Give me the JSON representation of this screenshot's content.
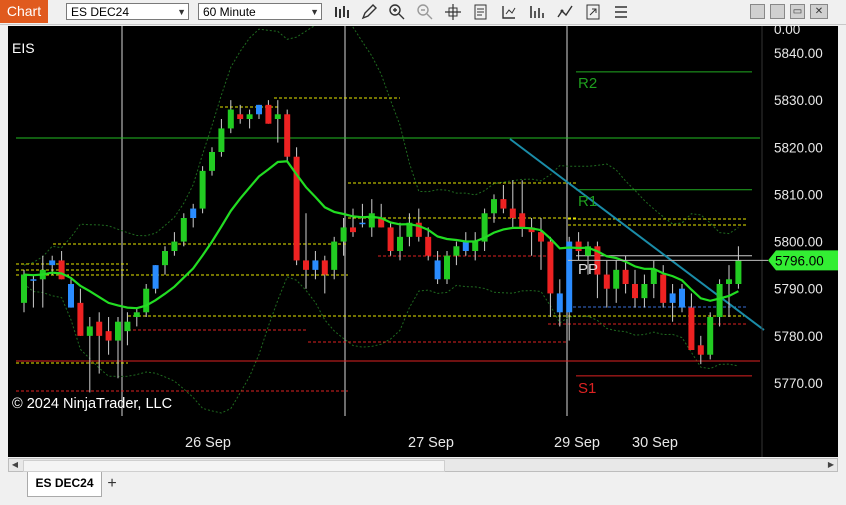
{
  "toolbar": {
    "chart_label": "Chart",
    "instrument": "ES DEC24",
    "interval": "60 Minute",
    "icons": [
      "bars-type-icon",
      "draw-pencil-icon",
      "zoom-in-icon",
      "zoom-out-icon",
      "crosshair-icon",
      "properties-icon",
      "strategies-icon",
      "indicators-icon",
      "templates-icon",
      "share-icon",
      "more-icon"
    ],
    "window_buttons": [
      "minimize",
      "maximize",
      "close"
    ]
  },
  "chart": {
    "symbol_label": "EIS",
    "copyright": "© 2024 NinjaTrader, LLC",
    "x_labels": [
      "26 Sep",
      "27 Sep",
      "29 Sep",
      "30 Sep"
    ],
    "y_labels": [
      "5840.00",
      "5830.00",
      "5820.00",
      "5810.00",
      "5800.00",
      "5790.00",
      "5780.00",
      "5770.00"
    ],
    "top_partial_label": "0.00",
    "current_price": "5796.00",
    "pivot_labels": {
      "r2": "R2",
      "r1": "R1",
      "pp": "PP",
      "s1": "S1"
    },
    "colors": {
      "up": "#22cc22",
      "down": "#ee2222",
      "neutral": "#2a8cff",
      "ema": "#22dd22",
      "price_tag": "#33ee33",
      "trendline": "#1a8ca8"
    }
  },
  "chart_data": {
    "type": "candlestick",
    "ylim": [
      5766,
      5842
    ],
    "price_levels": {
      "R2": 5836,
      "R1": 5811,
      "PP": 5797,
      "S1": 5771.5
    },
    "last_price": 5796.0,
    "candles": [
      [
        5787,
        5794,
        5785,
        5793
      ],
      [
        5792,
        5793,
        5786,
        5792
      ],
      [
        5792,
        5797,
        5786,
        5794
      ],
      [
        5795,
        5797,
        5793,
        5796
      ],
      [
        5796,
        5798,
        5792,
        5792
      ],
      [
        5791,
        5792,
        5786,
        5786
      ],
      [
        5787,
        5790,
        5780,
        5780
      ],
      [
        5780,
        5784,
        5768,
        5782
      ],
      [
        5783,
        5785,
        5772,
        5780
      ],
      [
        5781,
        5784,
        5776,
        5779
      ],
      [
        5779,
        5784,
        5771,
        5783
      ],
      [
        5781,
        5785,
        5778,
        5783
      ],
      [
        5784,
        5786,
        5782,
        5785
      ],
      [
        5785,
        5791,
        5784,
        5790
      ],
      [
        5790,
        5795,
        5789,
        5795
      ],
      [
        5795,
        5799,
        5793,
        5798
      ],
      [
        5798,
        5802,
        5797,
        5800
      ],
      [
        5800,
        5806,
        5799,
        5805
      ],
      [
        5805,
        5808,
        5803,
        5807
      ],
      [
        5807,
        5816,
        5806,
        5815
      ],
      [
        5815,
        5820,
        5814,
        5819
      ],
      [
        5819,
        5826,
        5818,
        5824
      ],
      [
        5824,
        5830,
        5823,
        5828
      ],
      [
        5827,
        5829,
        5825,
        5826
      ],
      [
        5826,
        5828,
        5824,
        5827
      ],
      [
        5827,
        5829,
        5826,
        5829
      ],
      [
        5829,
        5830,
        5825,
        5825
      ],
      [
        5826,
        5830,
        5821,
        5827
      ],
      [
        5827,
        5828,
        5817,
        5818
      ],
      [
        5818,
        5820,
        5795,
        5796
      ],
      [
        5796,
        5806,
        5790,
        5794
      ],
      [
        5794,
        5798,
        5792,
        5796
      ],
      [
        5796,
        5797,
        5789,
        5793
      ],
      [
        5794,
        5801,
        5792,
        5800
      ],
      [
        5800,
        5805,
        5797,
        5803
      ],
      [
        5803,
        5807,
        5801,
        5802
      ],
      [
        5804,
        5808,
        5803,
        5804
      ],
      [
        5803,
        5809,
        5801,
        5806
      ],
      [
        5805,
        5808,
        5803,
        5803
      ],
      [
        5803,
        5804,
        5797,
        5798
      ],
      [
        5798,
        5804,
        5796,
        5801
      ],
      [
        5801,
        5806,
        5799,
        5804
      ],
      [
        5804,
        5807,
        5800,
        5801
      ],
      [
        5801,
        5803,
        5796,
        5797
      ],
      [
        5796,
        5798,
        5791,
        5792
      ],
      [
        5792,
        5798,
        5791,
        5797
      ],
      [
        5797,
        5800,
        5795,
        5799
      ],
      [
        5800,
        5802,
        5797,
        5798
      ],
      [
        5798,
        5802,
        5796,
        5800
      ],
      [
        5800,
        5807,
        5798,
        5806
      ],
      [
        5806,
        5810,
        5804,
        5809
      ],
      [
        5809,
        5812,
        5806,
        5807
      ],
      [
        5807,
        5813,
        5803,
        5805
      ],
      [
        5806,
        5813,
        5801,
        5803
      ],
      [
        5803,
        5805,
        5797,
        5802
      ],
      [
        5802,
        5805,
        5794,
        5800
      ],
      [
        5800,
        5801,
        5784,
        5789
      ],
      [
        5789,
        5792,
        5782,
        5785
      ],
      [
        5785,
        5801,
        5779,
        5800
      ],
      [
        5800,
        5802,
        5796,
        5798
      ],
      [
        5797,
        5800,
        5793,
        5799
      ],
      [
        5799,
        5800,
        5788,
        5793
      ],
      [
        5793,
        5796,
        5786,
        5790
      ],
      [
        5790,
        5796,
        5787,
        5794
      ],
      [
        5794,
        5797,
        5789,
        5791
      ],
      [
        5791,
        5794,
        5786,
        5788
      ],
      [
        5788,
        5793,
        5786,
        5791
      ],
      [
        5791,
        5796,
        5788,
        5794
      ],
      [
        5793,
        5795,
        5786,
        5787
      ],
      [
        5787,
        5791,
        5783,
        5789
      ],
      [
        5790,
        5791,
        5785,
        5786
      ],
      [
        5786,
        5789,
        5777,
        5777
      ],
      [
        5778,
        5780,
        5774,
        5776
      ],
      [
        5776,
        5785,
        5775,
        5784
      ],
      [
        5784,
        5792,
        5782,
        5791
      ],
      [
        5791,
        5795,
        5784,
        5792
      ],
      [
        5791,
        5799,
        5790,
        5796
      ]
    ]
  }
}
